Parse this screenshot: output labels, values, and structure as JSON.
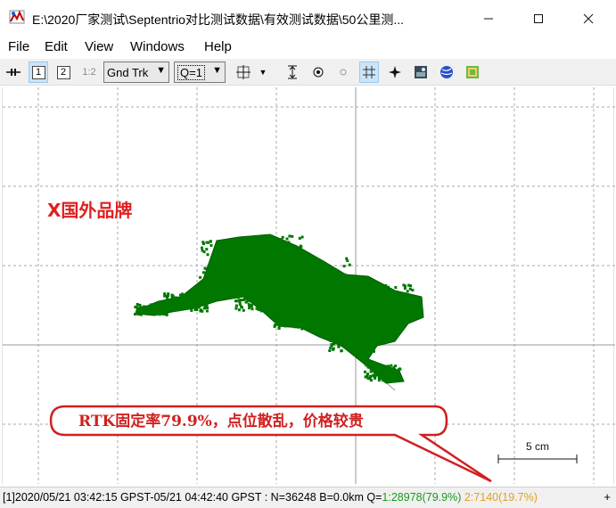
{
  "window": {
    "title": "E:\\2020厂家测试\\Septentrio对比测试数据\\有效测试数据\\50公里测..."
  },
  "menu": [
    "File",
    "Edit",
    "View",
    "Windows",
    "Help"
  ],
  "toolbar": {
    "btn1": "1",
    "btn2": "2",
    "btn12": "1:2",
    "plot_type": "Gnd Trk",
    "quality": "Q=1"
  },
  "plot": {
    "label": "X国外品牌",
    "callout": "RTK固定率79.9%，点位散乱，价格较贵",
    "scale": "5 cm"
  },
  "status": {
    "prefix": "[1]2020/05/21 03:42:15 GPST-05/21 04:42:40 GPST : N=36248 B=0.0km Q=",
    "q1": "1:28978(79.9%)",
    "q2": "2:7140(19.7%)",
    "plus": "+"
  },
  "colors": {
    "track": "#007800",
    "label_red": "#e02020",
    "callout_border": "#d02020",
    "status_green": "#1a9a1a",
    "status_orange": "#e0a020"
  }
}
